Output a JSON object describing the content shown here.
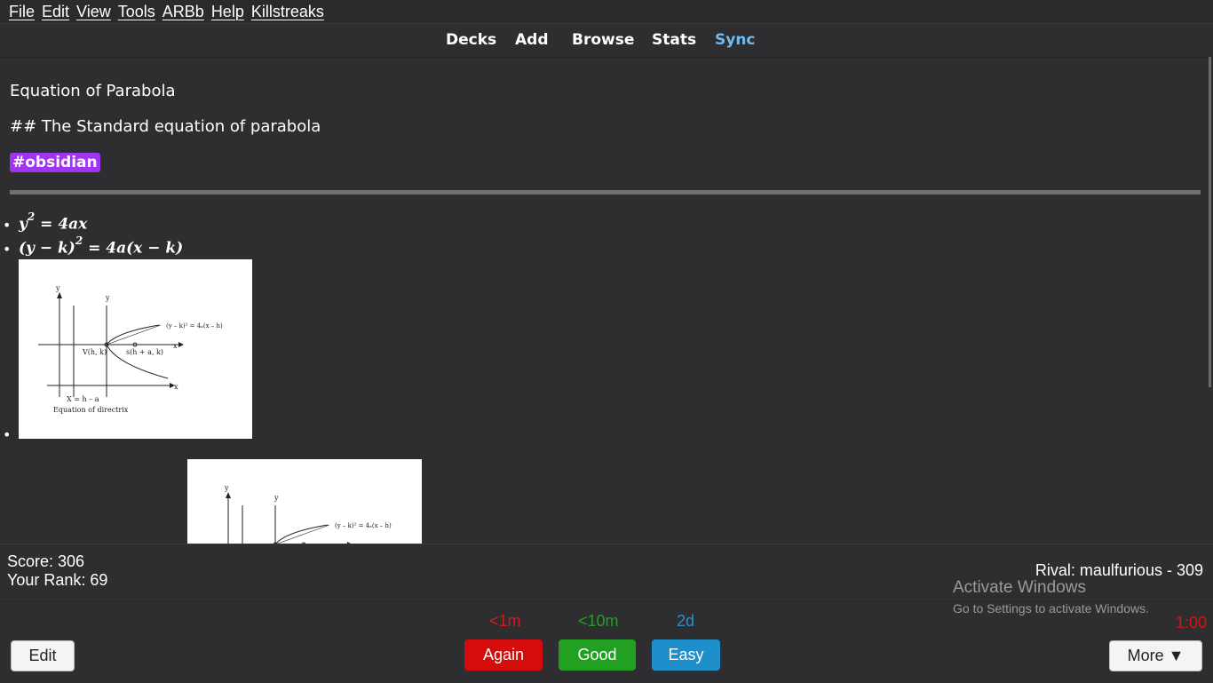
{
  "menu": [
    "File",
    "Edit",
    "View",
    "Tools",
    "ARBb",
    "Help",
    "Killstreaks"
  ],
  "toolbar": {
    "decks": "Decks",
    "add": "Add",
    "browse": "Browse",
    "stats": "Stats",
    "sync": "Sync",
    "sync_color": "#6ebcf2"
  },
  "card": {
    "title": "Equation of Parabola",
    "subtitle": "## The Standard equation of parabola",
    "tag": "#obsidian",
    "formulas": [
      {
        "base": "y",
        "sup": "2",
        "rest": " = 4ax"
      },
      {
        "base": "(y − k)",
        "sup": "2",
        "rest": " = 4a(x − k)"
      }
    ],
    "diagram": {
      "eq": "(y – k)² = 4ₐ(x – h)",
      "vertex": "V(h, k)",
      "focus": "s(h + a, k)",
      "directrix": "X = h – a",
      "directrix_caption": "Equation of directrix",
      "axis_y": "y",
      "axis_x": "x"
    }
  },
  "info": {
    "score": "Score: 306",
    "rank": "Your Rank: 69",
    "rival": "Rival: maulfurious - 309"
  },
  "watermark": {
    "line1": "Activate Windows",
    "line2": "Go to Settings to activate Windows."
  },
  "answer": {
    "again_ivl": "<1m",
    "good_ivl": "<10m",
    "easy_ivl": "2d",
    "again": "Again",
    "good": "Good",
    "easy": "Easy",
    "timer": "1:00",
    "edit": "Edit",
    "more": "More ▼"
  }
}
